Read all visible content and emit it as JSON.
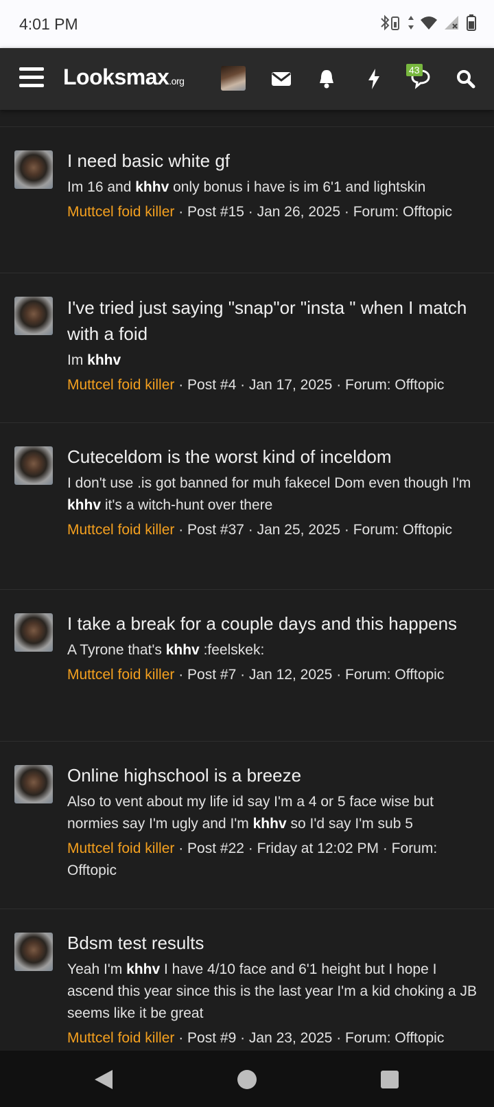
{
  "status_bar": {
    "time": "4:01 PM"
  },
  "header": {
    "logo_main": "Looksmax",
    "logo_suffix": ".org",
    "conversations_badge": "43"
  },
  "results": [
    {
      "title": "I need basic white gf",
      "snippet_before": "Im 16 and ",
      "snippet_bold": "khhv",
      "snippet_after": " only bonus i have is im 6'1 and lightskin",
      "user": "Muttcel foid killer",
      "details": " · Post #15 · Jan 26, 2025 · Forum: Offtopic"
    },
    {
      "title": "I've tried just saying \"snap\"or \"insta \" when I match with a foid",
      "snippet_before": "Im ",
      "snippet_bold": "khhv",
      "snippet_after": "",
      "user": "Muttcel foid killer",
      "details": " · Post #4 · Jan 17, 2025 · Forum: Offtopic"
    },
    {
      "title": "Cuteceldom is the worst kind of inceldom",
      "snippet_before": "I don't use .is got banned for muh fakecel Dom even though I'm ",
      "snippet_bold": "khhv",
      "snippet_after": " it's a witch-hunt over there",
      "user": "Muttcel foid killer",
      "details": " · Post #37 · Jan 25, 2025 · Forum: Offtopic"
    },
    {
      "title": "I take a break for a couple days and this happens",
      "snippet_before": "A Tyrone that's ",
      "snippet_bold": "khhv",
      "snippet_after": " :feelskek:",
      "user": "Muttcel foid killer",
      "details": " · Post #7 · Jan 12, 2025 · Forum: Offtopic"
    },
    {
      "title": "Online highschool is a breeze",
      "snippet_before": "Also to vent about my life id say I'm a 4 or 5 face wise but normies say I'm ugly and I'm ",
      "snippet_bold": "khhv",
      "snippet_after": " so I'd say I'm sub 5",
      "user": "Muttcel foid killer",
      "details": " · Post #22 · Friday at 12:02 PM · Forum: Offtopic"
    },
    {
      "title": "Bdsm test results",
      "snippet_before": "Yeah I'm ",
      "snippet_bold": "khhv",
      "snippet_after": " I have 4/10 face and 6'1 height but I hope I ascend this year since this is the last year I'm a kid choking a JB seems like it be great",
      "user": "Muttcel foid killer",
      "details": " · Post #9 · Jan 23, 2025 · Forum: Offtopic"
    }
  ]
}
